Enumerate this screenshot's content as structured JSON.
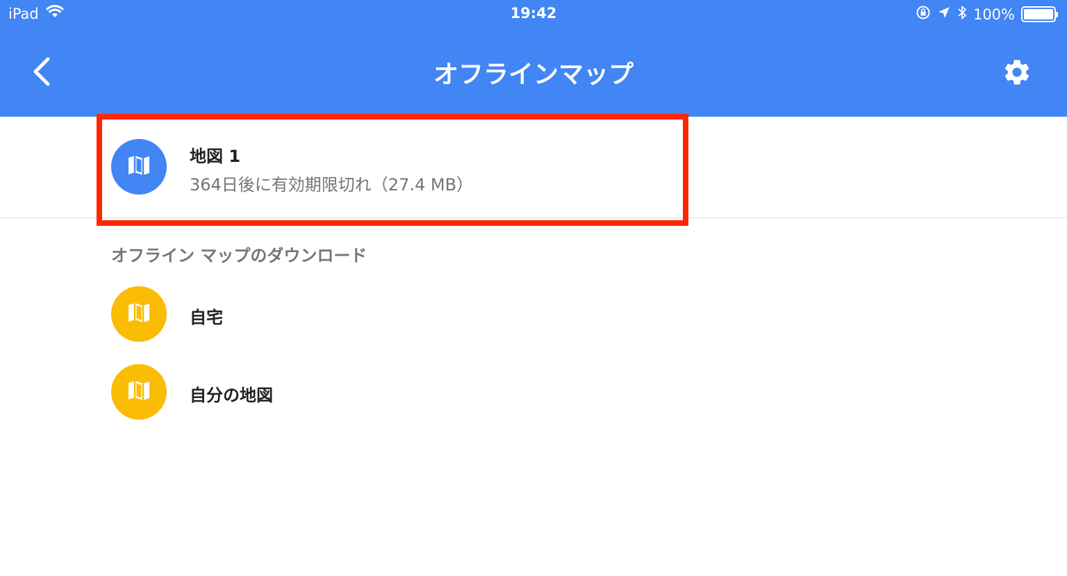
{
  "status_bar": {
    "device": "iPad",
    "time": "19:42",
    "battery": "100%"
  },
  "app_bar": {
    "title": "オフラインマップ"
  },
  "downloaded_maps": [
    {
      "title": "地図 1",
      "subtitle": "364日後に有効期限切れ（27.4 MB）",
      "icon": "map-icon",
      "icon_color": "#4285f4"
    }
  ],
  "download_section": {
    "header": "オフライン マップのダウンロード",
    "items": [
      {
        "label": "自宅",
        "icon": "map-icon",
        "icon_color": "#fbbc04"
      },
      {
        "label": "自分の地図",
        "icon": "map-icon",
        "icon_color": "#fbbc04"
      }
    ]
  },
  "colors": {
    "primary": "#4285f4",
    "accent_yellow": "#fbbc04",
    "highlight": "#ff2600"
  }
}
